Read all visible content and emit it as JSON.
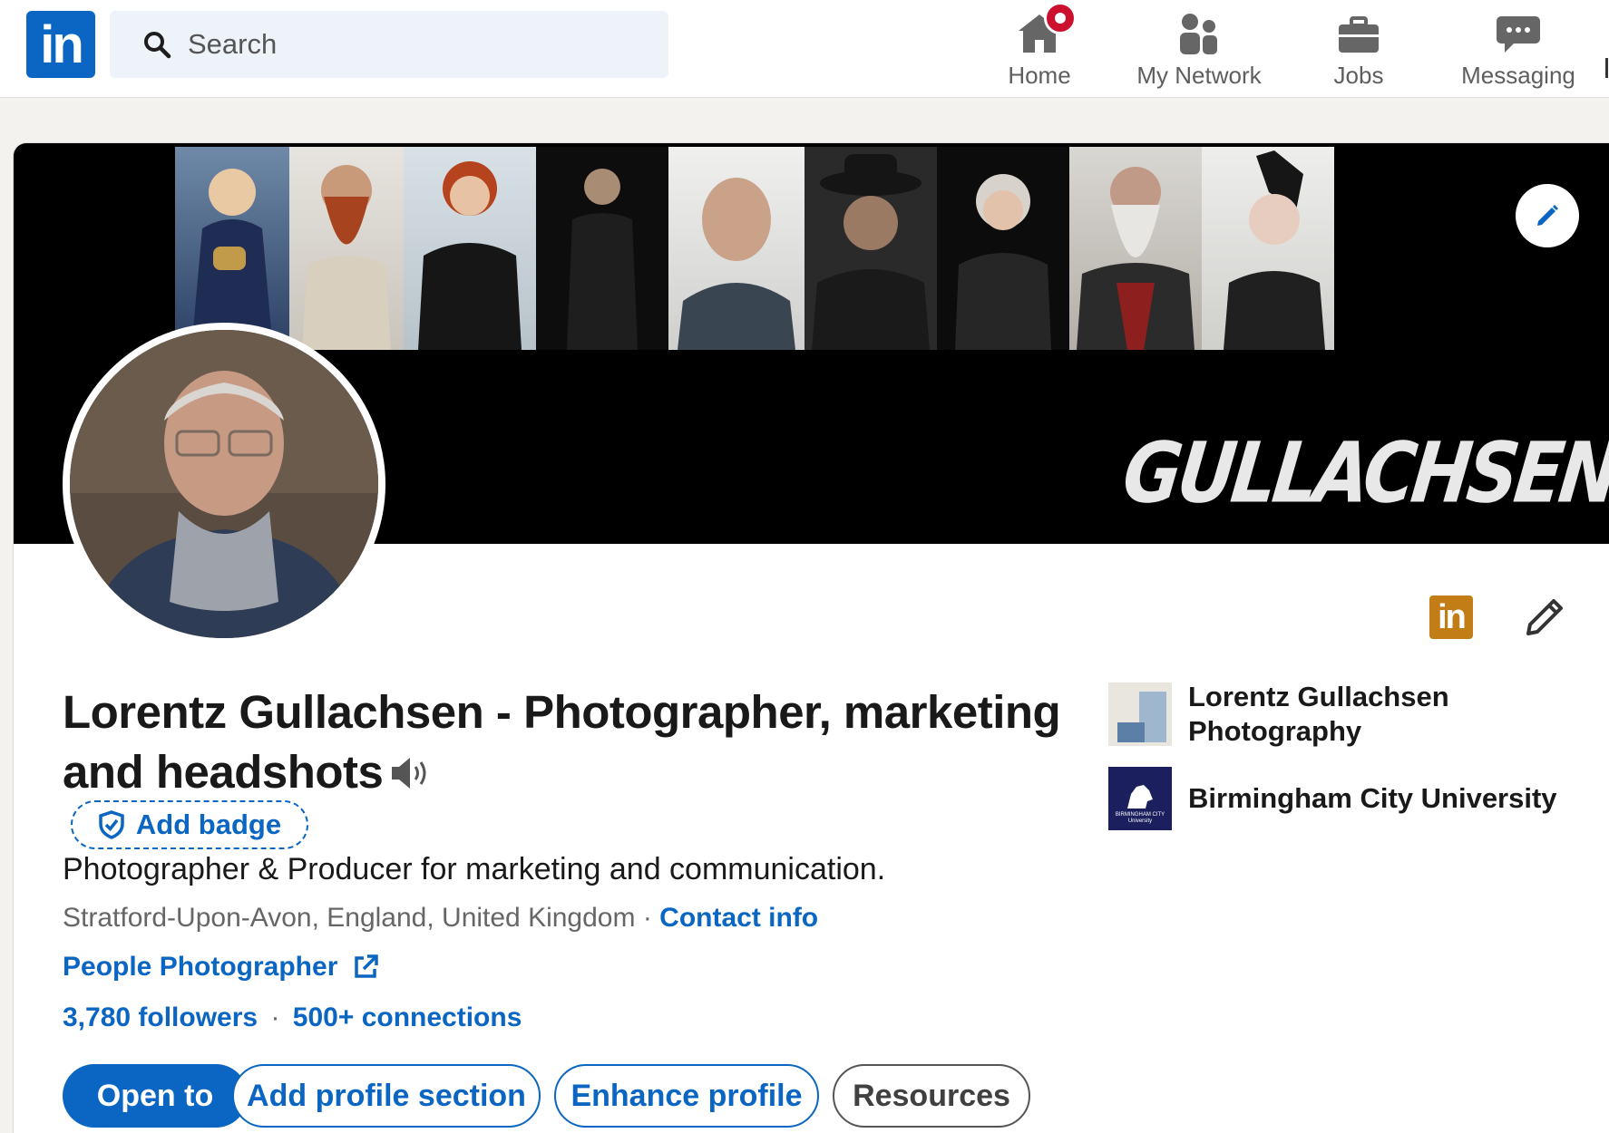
{
  "nav": {
    "logo_text": "in",
    "search_placeholder": "Search",
    "items": [
      {
        "label": "Home",
        "icon": "home-icon"
      },
      {
        "label": "My Network",
        "icon": "people-icon"
      },
      {
        "label": "Jobs",
        "icon": "briefcase-icon"
      },
      {
        "label": "Messaging",
        "icon": "chat-icon"
      }
    ]
  },
  "banner": {
    "wordmark": "GULLACHSEN"
  },
  "profile": {
    "name": "Lorentz Gullachsen - Photographer, marketing and headshots",
    "add_badge_label": "Add badge",
    "headline": "Photographer & Producer for marketing and communication.",
    "location": "Stratford-Upon-Avon, England, United Kingdom",
    "location_separator": " · ",
    "contact_info": "Contact info",
    "website_label": "People Photographer",
    "followers": "3,780 followers",
    "stats_separator": "·",
    "connections": "500+ connections",
    "premium_logo_text": "in"
  },
  "side": {
    "company": "Lorentz Gullachsen Photography",
    "education": "Birmingham City University",
    "education_logo_text": "BIRMINGHAM CITY University"
  },
  "actions": {
    "open_to": "Open to",
    "add_section": "Add profile section",
    "enhance": "Enhance profile",
    "resources": "Resources"
  },
  "colors": {
    "brand_blue": "#0a66c2",
    "notification_red": "#cb112d",
    "premium_gold": "#c37d16",
    "university_navy": "#1b1f5e"
  }
}
